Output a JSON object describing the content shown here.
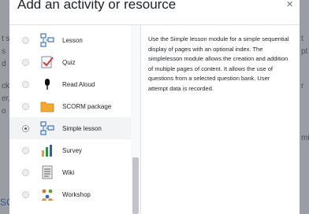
{
  "dialog": {
    "title": "Add an activity or resource",
    "close_label": "×"
  },
  "options": [
    {
      "label": "Lesson",
      "icon": "lesson-icon",
      "selected": false
    },
    {
      "label": "Quiz",
      "icon": "quiz-icon",
      "selected": false
    },
    {
      "label": "Read Aloud",
      "icon": "microphone-icon",
      "selected": false
    },
    {
      "label": "SCORM package",
      "icon": "scorm-icon",
      "selected": false
    },
    {
      "label": "Simple lesson",
      "icon": "simple-lesson-icon",
      "selected": true
    },
    {
      "label": "Survey",
      "icon": "survey-icon",
      "selected": false
    },
    {
      "label": "Wiki",
      "icon": "wiki-icon",
      "selected": false
    },
    {
      "label": "Workshop",
      "icon": "workshop-icon",
      "selected": false
    }
  ],
  "description": "Use the Simple lesson module for a simple sequential display of pages with an optional index. The simplelesson module allows the creation and addition of multiple pages of content. It allows the use of questions from a selected question bank. User attempt data is recorded.",
  "colors": {
    "accent": "#0f6cbf",
    "selected_row": "#f1f3f5",
    "backdrop": "#9a9ea4"
  }
}
